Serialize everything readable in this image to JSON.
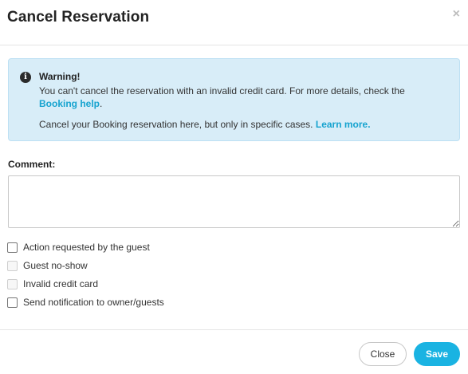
{
  "modal": {
    "title": "Cancel Reservation",
    "close_icon": "×"
  },
  "alert": {
    "icon": "info-icon",
    "title": "Warning!",
    "line1_text": "You can't cancel the reservation with an invalid credit card. For more details, check the ",
    "line1_link": "Booking help",
    "line1_end": ".",
    "line2_text": "Cancel your Booking reservation here, but only in specific cases. ",
    "line2_link": "Learn more.",
    "background_color": "#d8edf8",
    "link_color": "#16a3cf"
  },
  "comment": {
    "label": "Comment:",
    "value": "",
    "placeholder": ""
  },
  "options": [
    {
      "label": "Action requested by the guest",
      "checked": false,
      "disabled": false
    },
    {
      "label": "Guest no-show",
      "checked": false,
      "disabled": true
    },
    {
      "label": "Invalid credit card",
      "checked": false,
      "disabled": true
    },
    {
      "label": "Send notification to owner/guests",
      "checked": false,
      "disabled": false
    }
  ],
  "footer": {
    "close_label": "Close",
    "save_label": "Save",
    "save_color": "#1ab3e2"
  }
}
